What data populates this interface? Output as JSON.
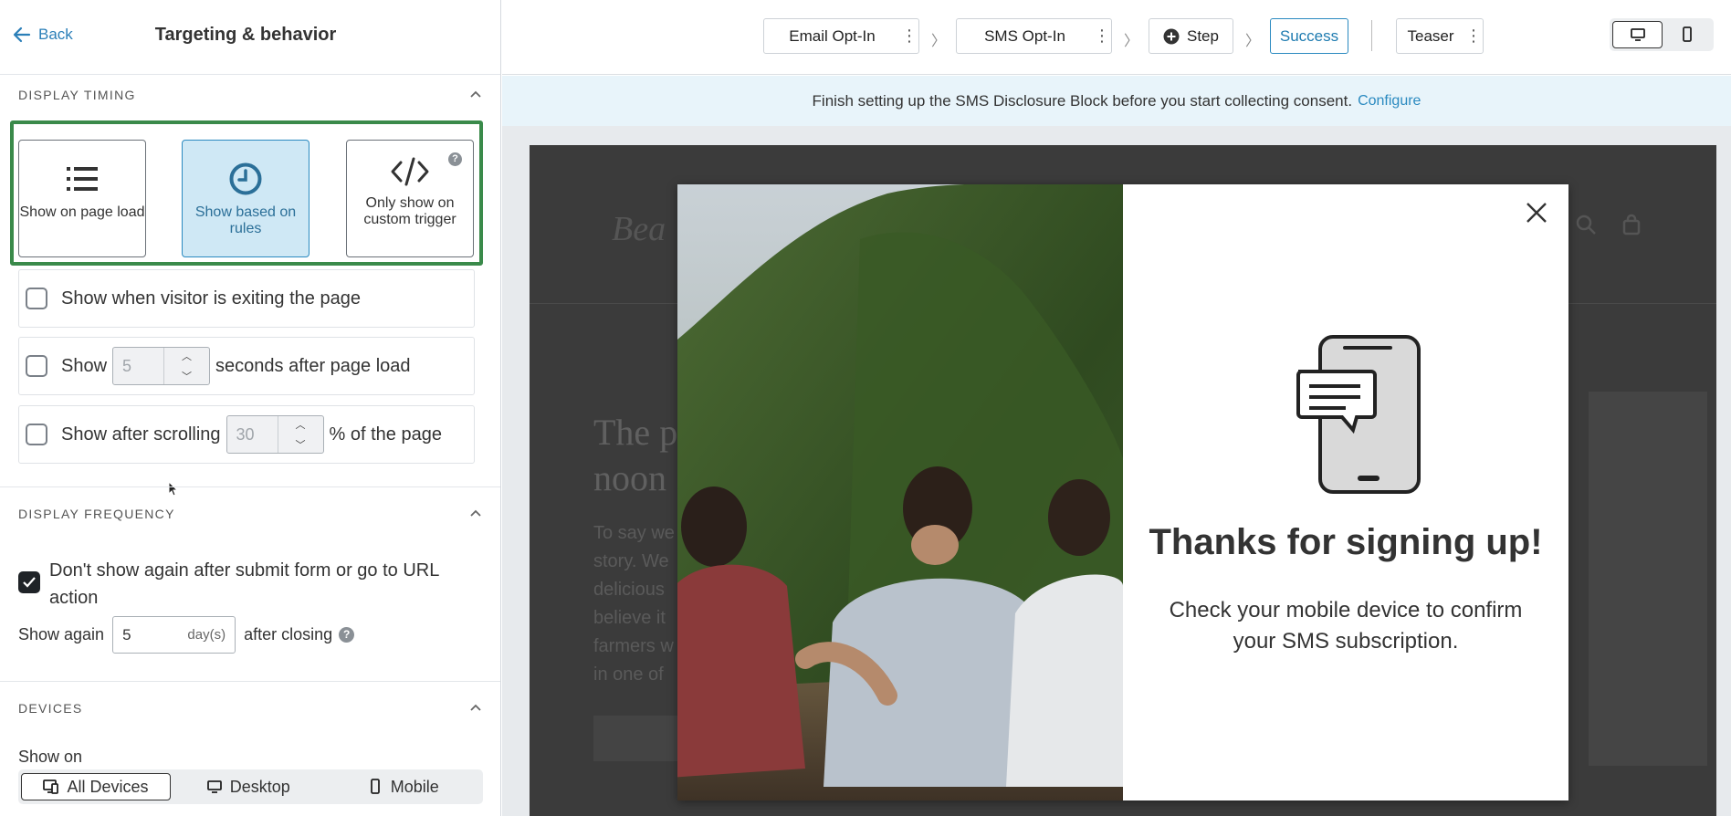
{
  "panel": {
    "back_label": "Back",
    "title": "Targeting & behavior"
  },
  "display_timing": {
    "heading": "DISPLAY TIMING",
    "options": [
      {
        "label": "Show on page load",
        "icon": "list-icon"
      },
      {
        "label": "Show based on rules",
        "icon": "clock-icon",
        "selected": true
      },
      {
        "label": "Only show on custom trigger",
        "icon": "code-icon"
      }
    ],
    "rules": {
      "exit_label": "Show when visitor is exiting the page",
      "delay_prefix": "Show",
      "delay_value": "5",
      "delay_suffix": "seconds after page load",
      "scroll_prefix": "Show after scrolling",
      "scroll_value": "30",
      "scroll_suffix": "% of the page"
    }
  },
  "display_frequency": {
    "heading": "DISPLAY FREQUENCY",
    "dont_show_label": "Don't show again after submit form or go to URL action",
    "dont_show_checked": true,
    "show_again_prefix": "Show again",
    "show_again_value": "5",
    "show_again_unit": "day(s)",
    "show_again_suffix": "after closing"
  },
  "devices": {
    "heading": "DEVICES",
    "show_on_label": "Show on",
    "options": [
      "All Devices",
      "Desktop",
      "Mobile"
    ],
    "selected": "All Devices"
  },
  "topbar": {
    "steps": [
      "Email Opt-In",
      "SMS Opt-In",
      "Step",
      "Success",
      "Teaser"
    ],
    "active_step": "Success",
    "view_mode": "desktop"
  },
  "banner": {
    "text": "Finish setting up the SMS Disclosure Block before you start collecting consent.",
    "link": "Configure"
  },
  "modal": {
    "heading": "Thanks for signing up!",
    "body": "Check your mobile device to confirm your SMS subscription."
  },
  "site": {
    "logo": "Bea",
    "title_line1": "The p",
    "title_line2": "noon",
    "text_lines": [
      "To say we",
      "story. We",
      "delicious",
      "believe it",
      "farmers w",
      "in one of"
    ]
  },
  "colors": {
    "accent": "#2b8ac0",
    "selection_border": "#3a8a4a",
    "selected_bg": "#cfe8f5",
    "banner_bg": "#e8f4fa"
  }
}
